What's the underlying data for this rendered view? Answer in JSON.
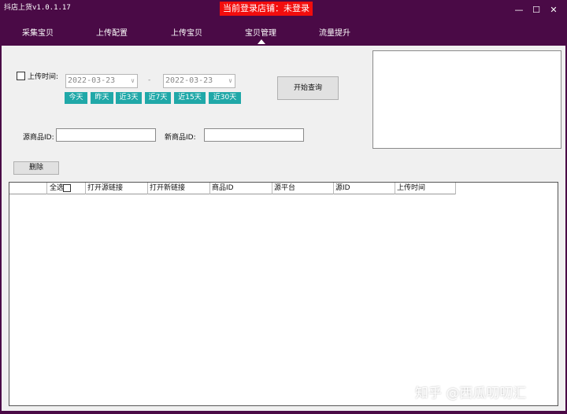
{
  "window": {
    "title": "抖店上货v1.0.1.17",
    "login_status": "当前登录店铺：未登录",
    "minimize_label": "—",
    "maximize_label": "☐",
    "close_label": "✕"
  },
  "nav": {
    "items": [
      "采集宝贝",
      "上传配置",
      "上传宝贝",
      "宝贝管理",
      "流量提升"
    ],
    "active": "宝贝管理"
  },
  "filter": {
    "upload_time_label": "上传时间:",
    "upload_time_checked": false,
    "start_date": "2022-03-23",
    "date_separator": "-",
    "end_date": "2022-03-23",
    "quick_ranges": [
      "今天",
      "昨天",
      "近3天",
      "近7天",
      "近15天",
      "近30天"
    ],
    "query_button": "开始查询",
    "source_id_label": "源商品ID:",
    "source_id_value": "",
    "new_id_label": "新商品ID:",
    "new_id_value": "",
    "delete_button": "删除"
  },
  "table": {
    "select_all_label": "全选",
    "columns": [
      "打开源链接",
      "打开新链接",
      "商品ID",
      "源平台",
      "源ID",
      "上传时间"
    ],
    "rows": []
  },
  "colors": {
    "frame": "#4a0a46",
    "login_badge": "#f20d0d",
    "quick_button": "#20a8a8",
    "content_bg": "#f0f0f0"
  },
  "watermark": "知乎 @西瓜叨叨汇"
}
